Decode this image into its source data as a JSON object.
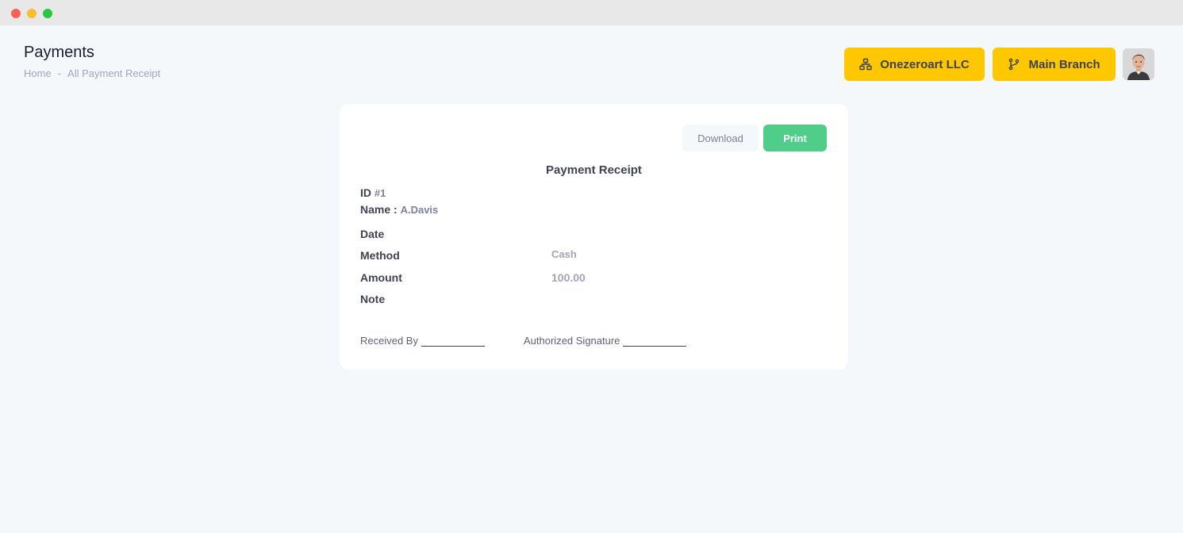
{
  "header": {
    "title": "Payments",
    "breadcrumb": [
      "Home",
      "-",
      "All Payment Receipt"
    ]
  },
  "topbar": {
    "company_label": "Onezeroart LLC",
    "company_icon": "sitemap-icon",
    "branch_label": "Main Branch",
    "branch_icon": "git-branch-icon"
  },
  "receipt": {
    "download_label": "Download",
    "print_label": "Print",
    "title": "Payment Receipt",
    "id_label": "ID",
    "id_value": "#1",
    "name_label": "Name :",
    "name_value": "A.Davis",
    "rows": [
      {
        "label": "Date",
        "value": ""
      },
      {
        "label": "Method",
        "value": "Cash"
      },
      {
        "label": "Amount",
        "value": "100.00"
      },
      {
        "label": "Note",
        "value": ""
      }
    ],
    "received_by_label": "Received By",
    "authorized_label": "Authorized Signature"
  },
  "colors": {
    "accent": "#ffc700",
    "print": "#50cd89",
    "background": "#f5f8fa"
  }
}
